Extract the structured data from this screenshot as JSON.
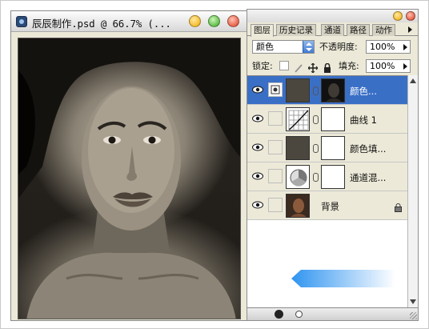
{
  "document": {
    "title": "辰辰制作.psd @ 66.7% (..."
  },
  "panel": {
    "tabs": [
      "图层",
      "历史记录",
      "通道",
      "路径",
      "动作"
    ],
    "blend_mode": "颜色",
    "opacity_label": "不透明度:",
    "opacity_value": "100%",
    "lock_label": "锁定:",
    "fill_label": "填充:",
    "fill_value": "100%"
  },
  "layers": [
    {
      "name": "颜色...",
      "selected": true,
      "visible": true,
      "thumb": "color-fill-dark"
    },
    {
      "name": "曲线 1",
      "selected": false,
      "visible": true,
      "thumb": "curves"
    },
    {
      "name": "颜色填...",
      "selected": false,
      "visible": true,
      "thumb": "color-fill-dark"
    },
    {
      "name": "通道混...",
      "selected": false,
      "visible": true,
      "thumb": "channel-mixer"
    },
    {
      "name": "背景",
      "selected": false,
      "visible": true,
      "thumb": "photo",
      "locked": true
    }
  ],
  "colors": {
    "selection": "#3a6fc6",
    "fill_swatch": "#4b473f",
    "accent_arrow": "#2f94f0"
  }
}
